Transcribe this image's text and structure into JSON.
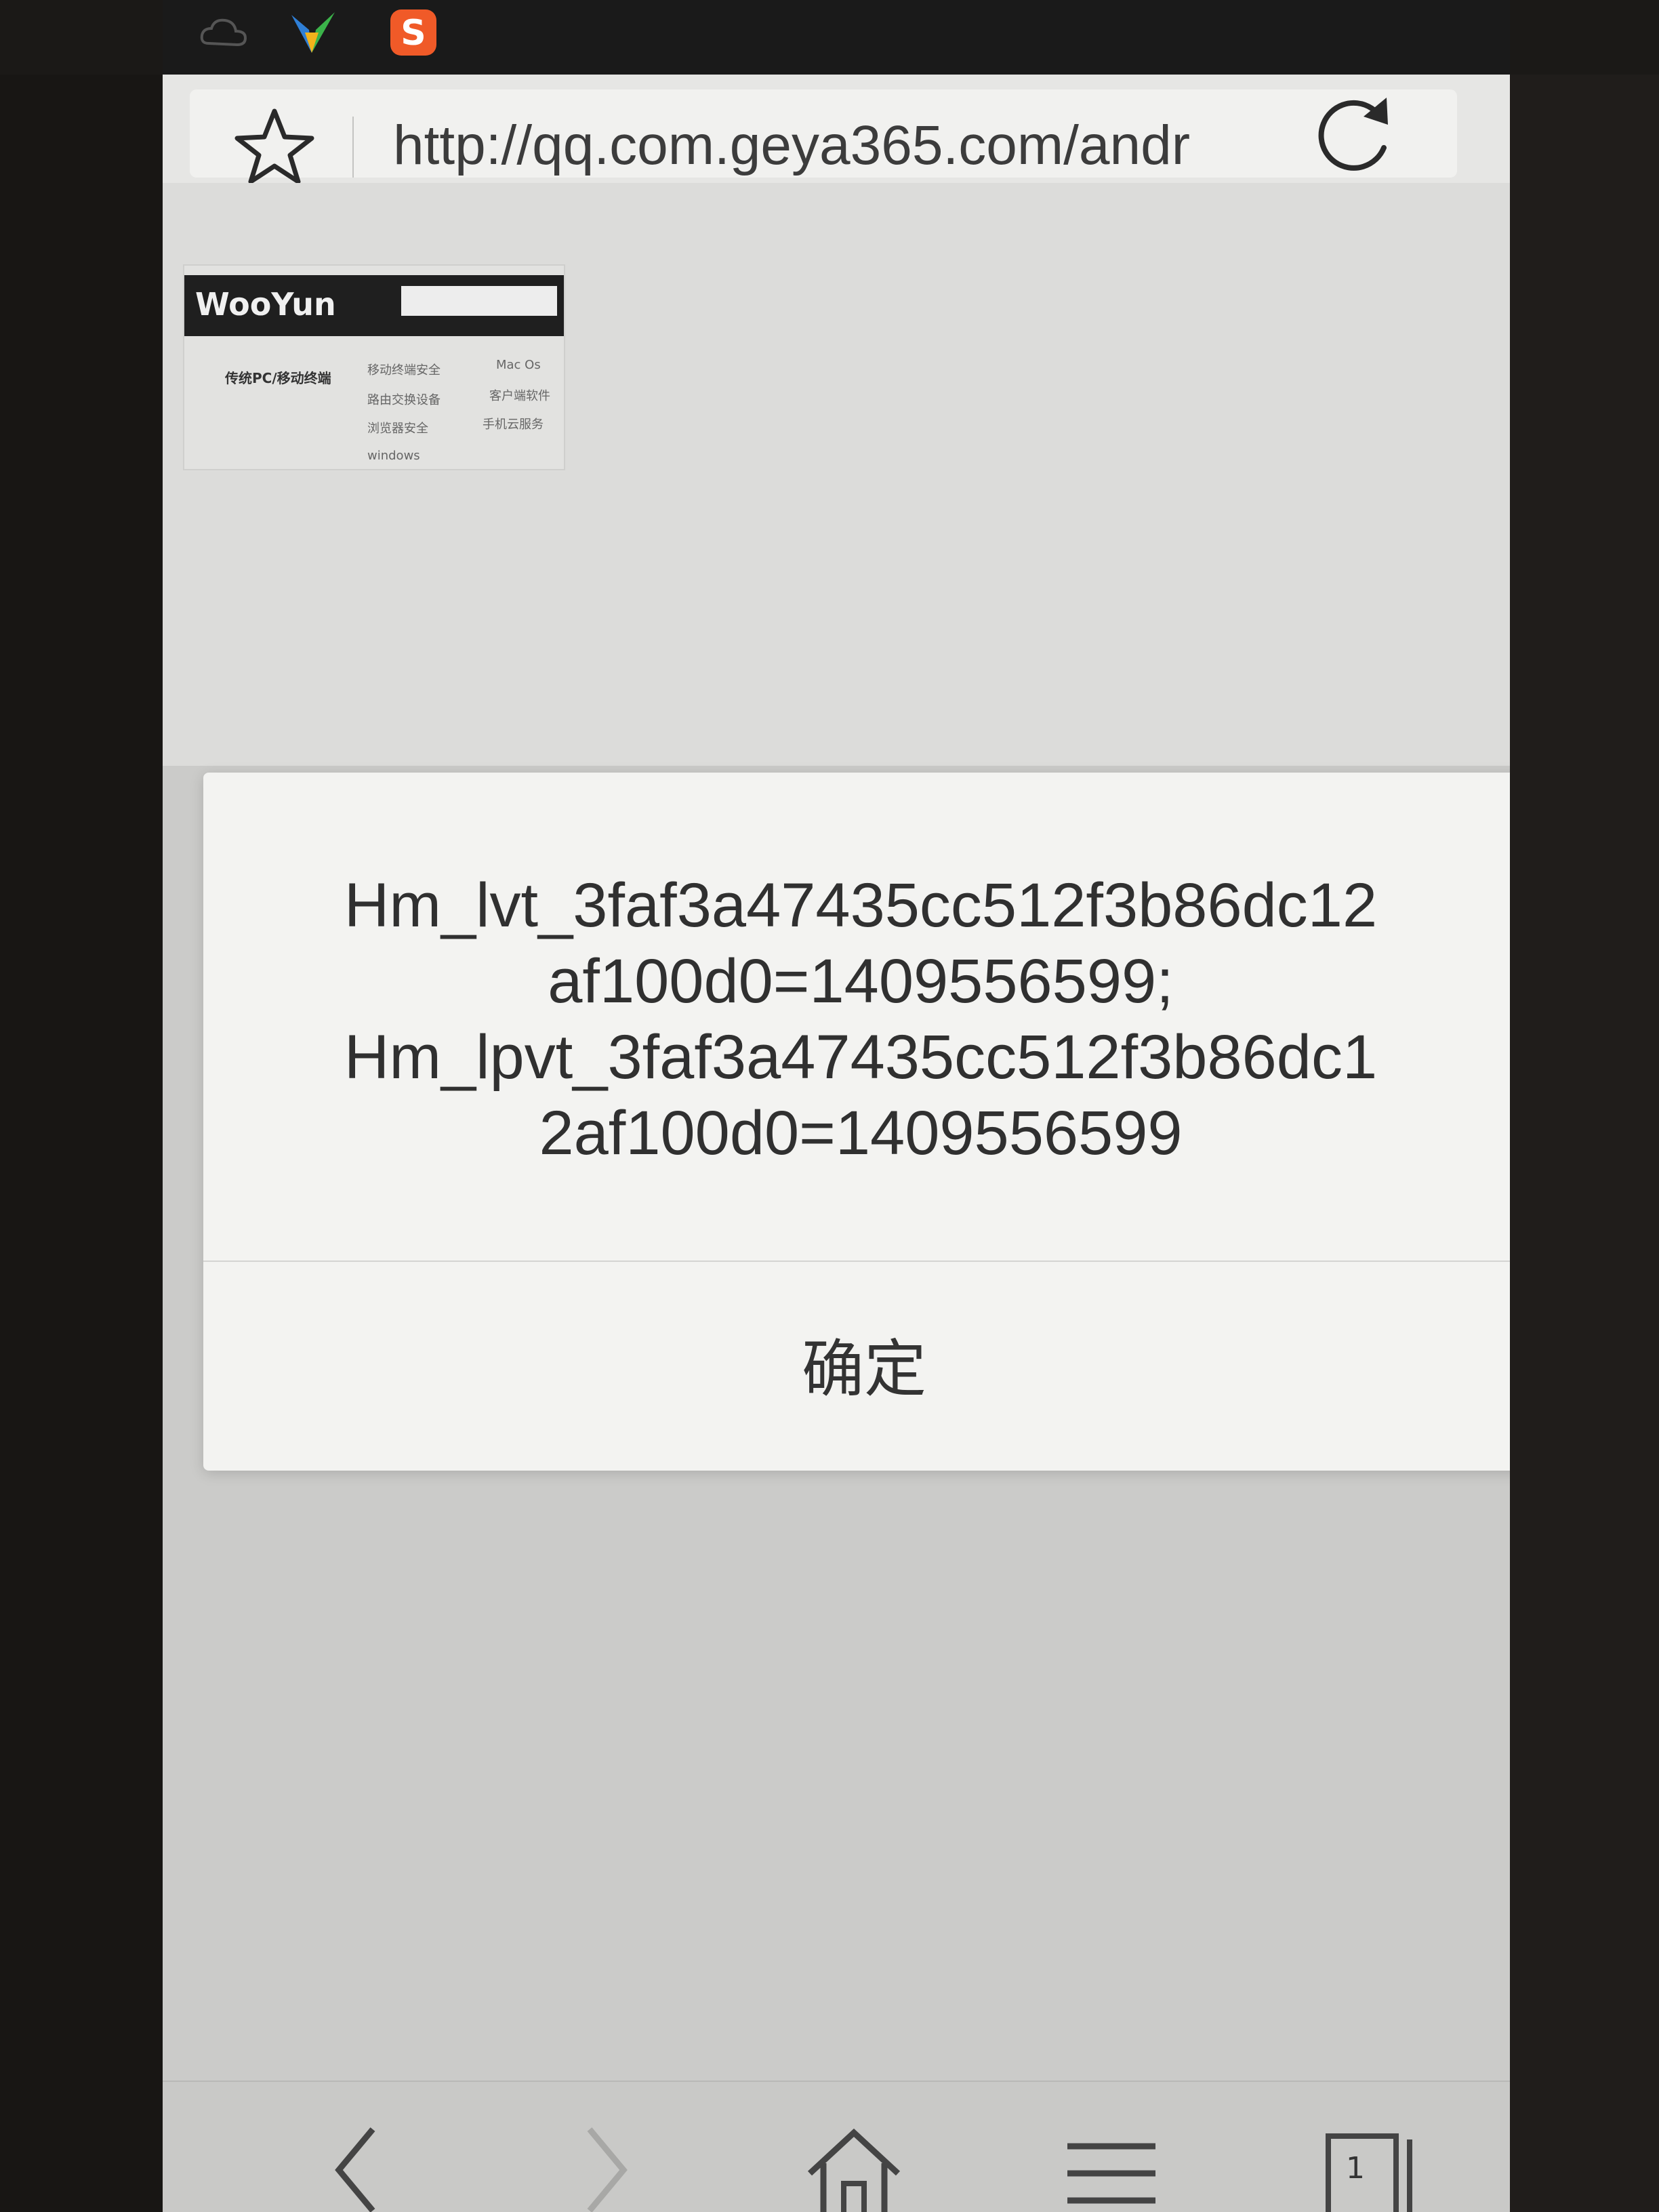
{
  "browser": {
    "url": "http://qq.com.geya365.com/andr",
    "tab_count": "1"
  },
  "page": {
    "wooyun": {
      "logo": "WooYun",
      "left_menu": "传统PC/移动终端",
      "links": [
        "移动终端安全",
        "Mac Os",
        "路由交换设备",
        "客户端软件",
        "浏览器安全",
        "手机云服务",
        "windows"
      ]
    }
  },
  "dialog": {
    "message_lines": [
      "Hm_lvt_3faf3a47435cc512f3b86dc12",
      "af100d0=1409556599;",
      "Hm_lpvt_3faf3a47435cc512f3b86dc1",
      "2af100d0=1409556599"
    ],
    "confirm_label": "确定"
  },
  "colors": {
    "screen_bg": "#dcdcda",
    "dialog_bg": "#f3f3f1",
    "status_bar": "#1a1a1a"
  }
}
